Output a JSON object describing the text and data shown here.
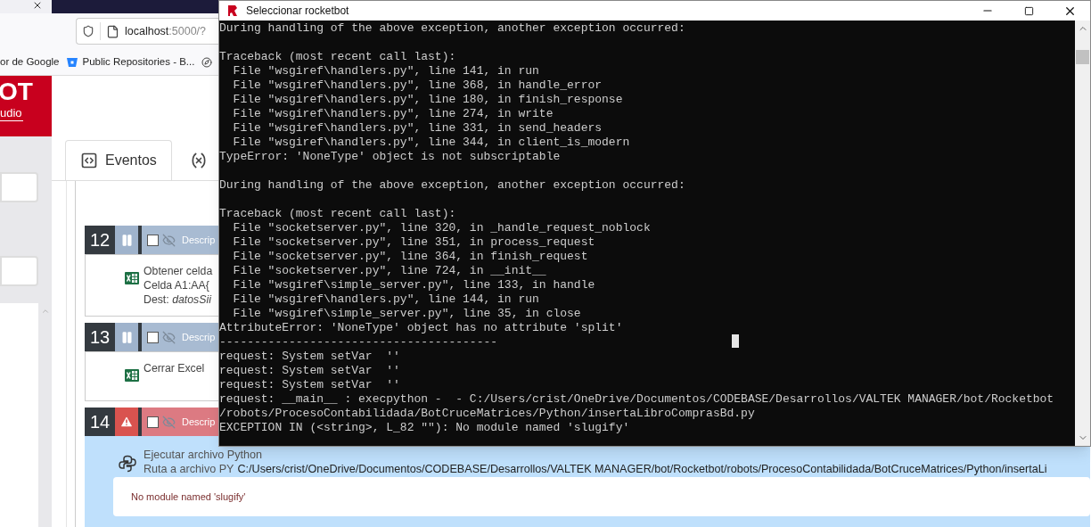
{
  "browser": {
    "url": {
      "host": "localhost",
      "path": ":5000/?"
    },
    "bookmarks": [
      {
        "label": "or de Google",
        "kind": "plain"
      },
      {
        "label": "Public Repositories - B...",
        "kind": "repo"
      }
    ]
  },
  "app": {
    "logo": {
      "title": "OT",
      "subtitle": "udio"
    },
    "tabs": [
      {
        "label": "Eventos",
        "kind": "events",
        "selected": true
      },
      {
        "kind": "variables",
        "selected": false
      }
    ],
    "steps": [
      {
        "number": "12",
        "failed": false,
        "kind": "excel",
        "header": "Descrip",
        "checked": false,
        "lines": [
          "Obtener celda",
          "Celda A1:AA{",
          "Dest: *datosSii*"
        ]
      },
      {
        "number": "13",
        "failed": false,
        "kind": "excel",
        "header": "Descrip",
        "checked": false,
        "lines": [
          "Cerrar Excel"
        ]
      },
      {
        "number": "14",
        "failed": true,
        "kind": "python",
        "header": "Descrip",
        "checked": false,
        "lines": [
          "Ejecutar archivo Python"
        ],
        "path": {
          "label": "Ruta a archivo PY",
          "value": "C:/Users/crist/OneDrive/Documentos/CODEBASE/Desarrollos/VALTEK MANAGER/bot/Rocketbot/robots/ProcesoContabilidada/BotCruceMatrices/Python/insertaLi"
        },
        "error": "No module named 'slugify'"
      }
    ]
  },
  "console": {
    "title": "Seleccionar rocketbot",
    "blocks": [
      [
        "During handling of the above exception, another exception occurred:"
      ],
      [
        "Traceback (most recent call last):",
        "  File \"wsgiref\\handlers.py\", line 141, in run",
        "  File \"wsgiref\\handlers.py\", line 368, in handle_error",
        "  File \"wsgiref\\handlers.py\", line 180, in finish_response",
        "  File \"wsgiref\\handlers.py\", line 274, in write",
        "  File \"wsgiref\\handlers.py\", line 331, in send_headers",
        "  File \"wsgiref\\handlers.py\", line 344, in client_is_modern",
        "TypeError: 'NoneType' object is not subscriptable"
      ],
      [
        "During handling of the above exception, another exception occurred:"
      ],
      [
        "Traceback (most recent call last):",
        "  File \"socketserver.py\", line 320, in _handle_request_noblock",
        "  File \"socketserver.py\", line 351, in process_request",
        "  File \"socketserver.py\", line 364, in finish_request",
        "  File \"socketserver.py\", line 724, in __init__",
        "  File \"wsgiref\\simple_server.py\", line 133, in handle",
        "  File \"wsgiref\\handlers.py\", line 144, in run",
        "  File \"wsgiref\\simple_server.py\", line 35, in close",
        "AttributeError: 'NoneType' object has no attribute 'split'",
        "----------------------------------------",
        "request: System setVar  ''",
        "request: System setVar  ''",
        "request: System setVar  ''",
        "request: __main__ : execpython -  - C:/Users/crist/OneDrive/Documentos/CODEBASE/Desarrollos/VALTEK MANAGER/bot/Rocketbot",
        "/robots/ProcesoContabilidada/BotCruceMatrices/Python/insertaLibroComprasBd.py",
        "EXCEPTION IN (<string>, L_82 \"\"): No module named 'slugify'"
      ]
    ]
  }
}
